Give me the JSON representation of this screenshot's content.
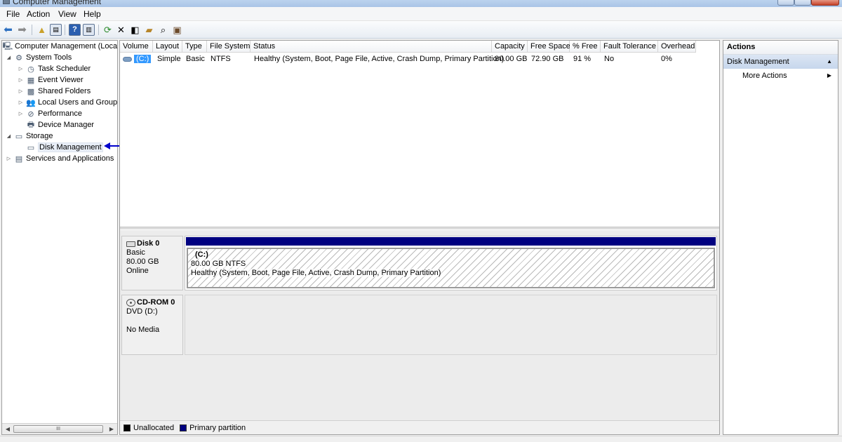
{
  "window": {
    "title": "Computer Management"
  },
  "menu": [
    "File",
    "Action",
    "View",
    "Help"
  ],
  "toolbar_icons": [
    "back-icon",
    "forward-icon",
    "up-folder-icon",
    "show-hide-tree-icon",
    "help-icon",
    "action-pane-icon",
    "refresh-icon",
    "delete-icon",
    "properties-icon",
    "open-folder-icon",
    "search-icon",
    "export-icon"
  ],
  "tree": {
    "root": "Computer Management (Local",
    "system_tools": "System Tools",
    "task_scheduler": "Task Scheduler",
    "event_viewer": "Event Viewer",
    "shared_folders": "Shared Folders",
    "local_users": "Local Users and Groups",
    "performance": "Performance",
    "device_manager": "Device Manager",
    "storage": "Storage",
    "disk_management": "Disk Management",
    "services": "Services and Applications",
    "scroll_thumb": "III"
  },
  "volumes": {
    "headers": [
      "Volume",
      "Layout",
      "Type",
      "File System",
      "Status",
      "Capacity",
      "Free Space",
      "% Free",
      "Fault Tolerance",
      "Overhead"
    ],
    "row": {
      "volume": "(C:)",
      "layout": "Simple",
      "type": "Basic",
      "fs": "NTFS",
      "status": "Healthy (System, Boot, Page File, Active, Crash Dump, Primary Partition)",
      "capacity": "80.00 GB",
      "free": "72.90 GB",
      "pct_free": "91 %",
      "fault": "No",
      "overhead": "0%"
    }
  },
  "disk0": {
    "name": "Disk 0",
    "type": "Basic",
    "size": "80.00 GB",
    "state": "Online",
    "partition": {
      "name": "(C:)",
      "size_fs": "80.00 GB NTFS",
      "status": "Healthy (System, Boot, Page File, Active, Crash Dump, Primary Partition)"
    }
  },
  "cdrom0": {
    "name": "CD-ROM 0",
    "drive": "DVD (D:)",
    "media": "No Media"
  },
  "legend": {
    "unallocated": "Unallocated",
    "primary": "Primary partition",
    "unallocated_color": "#000000",
    "primary_color": "#000080"
  },
  "actions": {
    "title": "Actions",
    "section": "Disk Management",
    "more": "More Actions"
  },
  "colors": {
    "primary_partition": "#000080",
    "selection": "#3399ff",
    "annotation_arrow": "#0000cc"
  }
}
